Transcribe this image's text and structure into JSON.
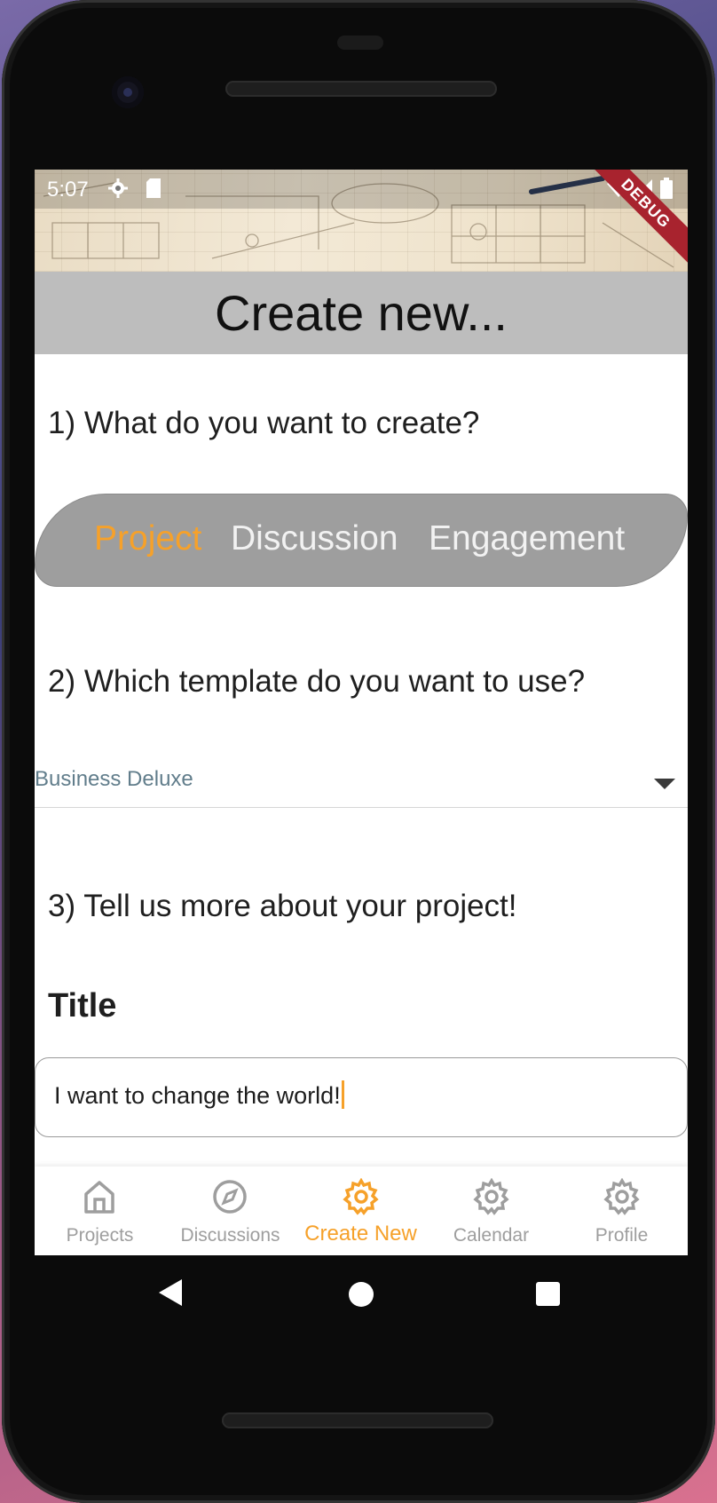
{
  "status_bar": {
    "time": "5:07",
    "debug_banner": "DEBUG",
    "icons": [
      "settings-icon",
      "sd-card-icon",
      "wifi-icon",
      "signal-icon",
      "battery-icon"
    ]
  },
  "page": {
    "title": "Create new..."
  },
  "question1": {
    "label": "1) What do you want to create?",
    "options": [
      {
        "label": "Project",
        "selected": true
      },
      {
        "label": "Discussion",
        "selected": false
      },
      {
        "label": "Engagement",
        "selected": false
      }
    ]
  },
  "question2": {
    "label": "2) Which template do you want to use?",
    "selected_template": "Business Deluxe"
  },
  "question3": {
    "label": "3) Tell us more about your project!",
    "title_label": "Title",
    "title_value": "I want to change the world!"
  },
  "bottom_nav": {
    "items": [
      {
        "label": "Projects",
        "icon": "home-icon",
        "active": false
      },
      {
        "label": "Discussions",
        "icon": "compass-icon",
        "active": false
      },
      {
        "label": "Create New",
        "icon": "gear-icon",
        "active": true
      },
      {
        "label": "Calendar",
        "icon": "gear-icon",
        "active": false
      },
      {
        "label": "Profile",
        "icon": "gear-icon",
        "active": false
      }
    ]
  },
  "colors": {
    "accent": "#f6a12a",
    "title_bar": "#bdbdbd",
    "segment_bg": "#9e9e9e",
    "dropdown_text": "#617d8b",
    "debug_ribbon": "#a8232e"
  }
}
